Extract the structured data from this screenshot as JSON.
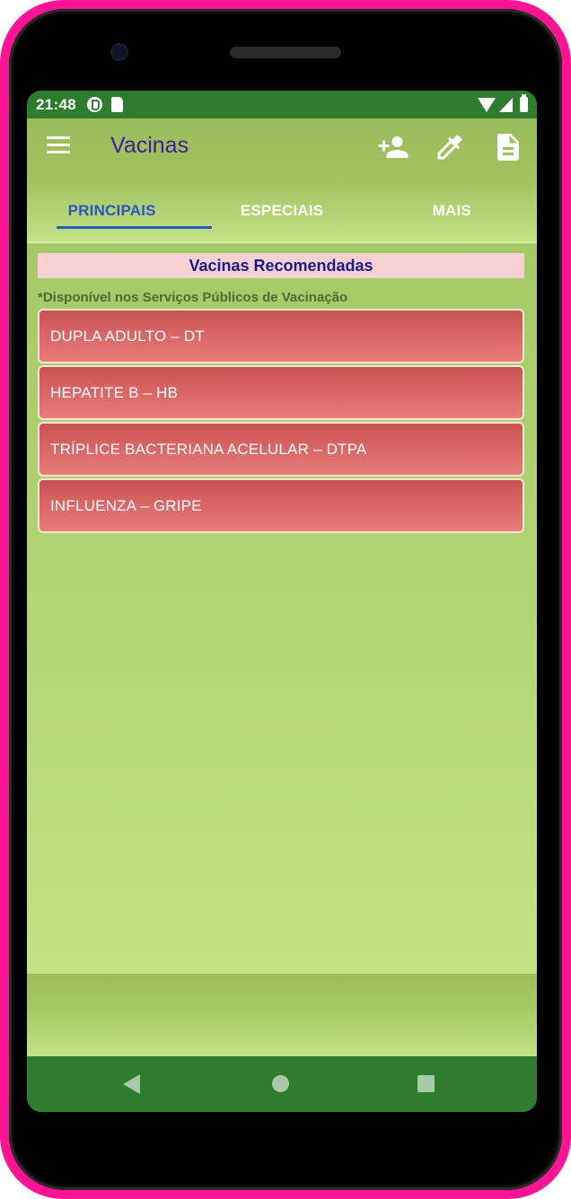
{
  "status_bar": {
    "time": "21:48",
    "left_icons": [
      "notification-p-icon",
      "sd-card-icon"
    ],
    "right_icons": [
      "wifi-icon",
      "signal-icon",
      "battery-icon"
    ]
  },
  "app_bar": {
    "title": "Vacinas",
    "menu_icon": "hamburger-menu-icon",
    "actions": [
      {
        "name": "add-person",
        "icon": "person-add-icon"
      },
      {
        "name": "eyedropper",
        "icon": "eyedropper-icon"
      },
      {
        "name": "document",
        "icon": "document-icon"
      }
    ]
  },
  "tabs": [
    {
      "label": "PRINCIPAIS",
      "active": true
    },
    {
      "label": "ESPECIAIS",
      "active": false
    },
    {
      "label": "MAIS",
      "active": false
    }
  ],
  "content": {
    "section_title": "Vacinas Recomendadas",
    "note": "*Disponível nos Serviços Públicos de Vacinação",
    "vaccines": [
      {
        "label": "DUPLA ADULTO – DT"
      },
      {
        "label": "HEPATITE B – HB"
      },
      {
        "label": "TRÍPLICE BACTERIANA ACELULAR – DTPA"
      },
      {
        "label": "INFLUENZA – GRIPE"
      }
    ]
  },
  "nav_bar": {
    "buttons": [
      "back-icon",
      "home-icon",
      "recents-icon"
    ]
  },
  "colors": {
    "frame": "#ff1493",
    "status_bar": "#2e7d2e",
    "app_title": "#3b1fa0",
    "active_tab": "#2a56c6",
    "section_header_bg": "#f7d0d2",
    "section_header_text": "#1d1a8e",
    "vaccine_item": "#d86565"
  }
}
